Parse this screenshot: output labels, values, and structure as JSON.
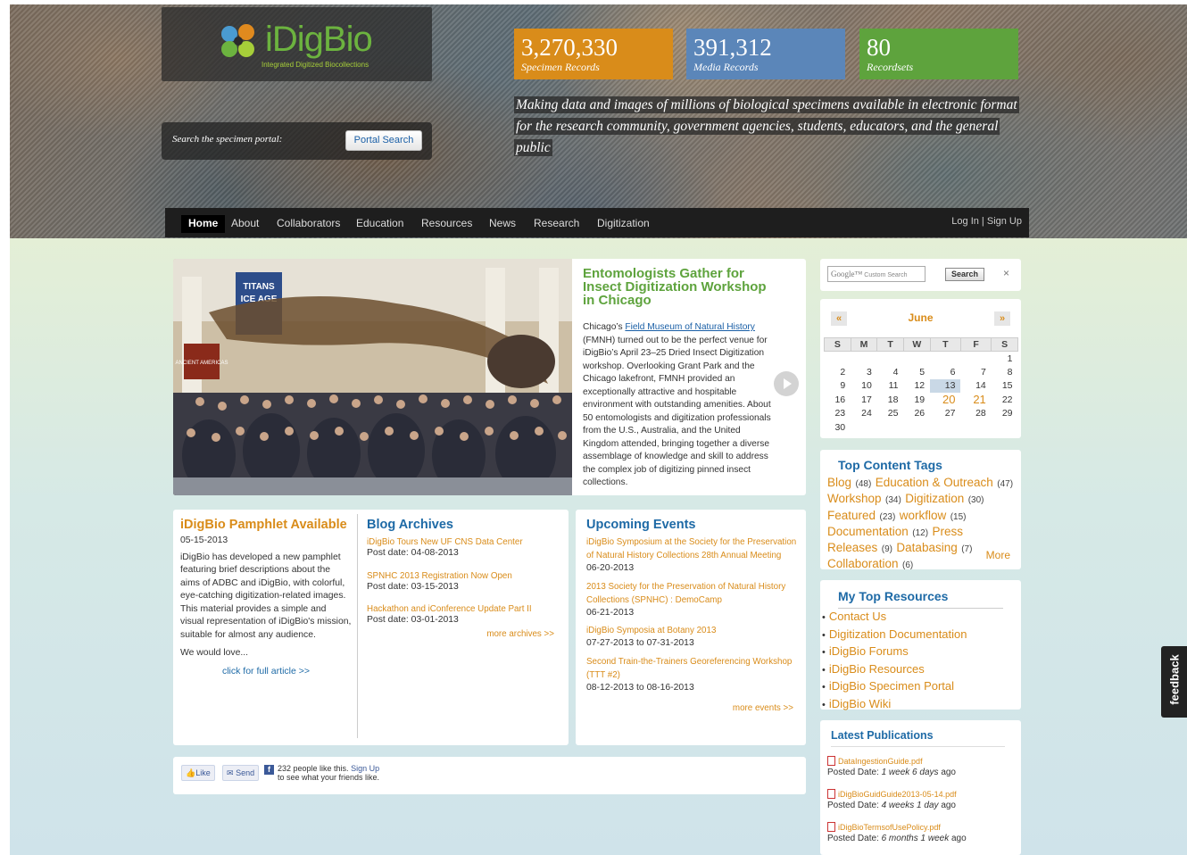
{
  "brand": {
    "logo_text": "iDigBio",
    "logo_sub": "Integrated Digitized Biocollections"
  },
  "search": {
    "label": "Search the specimen portal:",
    "button": "Portal Search"
  },
  "stats": [
    {
      "value": "3,270,330",
      "label": "Specimen Records",
      "color": "#d98c1a"
    },
    {
      "value": "391,312",
      "label": "Media Records",
      "color": "#5b86b9"
    },
    {
      "value": "80",
      "label": "Recordsets",
      "color": "#5ea33d"
    }
  ],
  "tagline": "Making data and images of millions of biological specimens available in electronic format for the research community, government agencies, students, educators, and the general public",
  "nav": {
    "items": [
      "Home",
      "About",
      "Collaborators",
      "Education",
      "Resources",
      "News",
      "Research",
      "Digitization"
    ],
    "active": "Home",
    "login": "Log In",
    "signup": "Sign Up"
  },
  "slide": {
    "title": "Entomologists Gather for Insect Digitization Workshop in Chicago",
    "body_pre": "Chicago’s ",
    "body_link": "Field Museum of Natural History",
    "body_post": " (FMNH) turned out to be the perfect venue for iDigBio’s April 23–25 Dried Insect Digitization workshop. Overlooking Grant Park and the Chicago lakefront, FMNH provided an exceptionally attractive and hospitable environment with outstanding amenities. About 50 entomologists and digitization professionals from the U.S., Australia, and the United Kingdom attended, bringing together a diverse assemblage of knowledge and skill to address the complex job of digitizing pinned insect collections.",
    "banner_1": "TITANS",
    "banner_2": "ICE AGE",
    "banner_3": "ANCIENT AMERICAS"
  },
  "pamphlet": {
    "title": "iDigBio Pamphlet Available",
    "date": "05-15-2013",
    "body": "iDigBio has developed a new pamphlet featuring brief descriptions about the aims of ADBC and iDigBio, with colorful, eye-catching digitization-related images. This material provides a simple and visual representation of iDigBio's mission, suitable for almost any audience.",
    "more": "We would love...",
    "link": "click for full article >>"
  },
  "archives": {
    "title": "Blog Archives",
    "items": [
      {
        "title": "iDigBio Tours New UF CNS Data Center",
        "date": "Post date: 04-08-2013"
      },
      {
        "title": "SPNHC 2013 Registration Now Open",
        "date": "Post date: 03-15-2013"
      },
      {
        "title": "Hackathon and iConference Update Part II",
        "date": "Post date: 03-01-2013"
      }
    ],
    "more": "more archives >>"
  },
  "events": {
    "title": "Upcoming Events",
    "items": [
      {
        "title": "iDigBio Symposium at the Society for the Preservation of Natural History Collections 28th Annual Meeting",
        "date": "06-20-2013"
      },
      {
        "title": "2013 Society for the Preservation of Natural History Collections (SPNHC) : DemoCamp",
        "date": "06-21-2013"
      },
      {
        "title": "iDigBio Symposia at Botany 2013",
        "date": "07-27-2013 to 07-31-2013"
      },
      {
        "title": "Second Train-the-Trainers Georeferencing Workshop (TTT #2)",
        "date": "08-12-2013 to 08-16-2013"
      }
    ],
    "more": "more events >>"
  },
  "social": {
    "like": "Like",
    "send": "Send",
    "count_text": "232 people like this.",
    "signup": "Sign Up",
    "rest": "to see what your friends like."
  },
  "google": {
    "placeholder": "Custom Search",
    "google": "Google™",
    "button": "Search",
    "clear": "×"
  },
  "calendar": {
    "month": "June",
    "prev": "«",
    "next": "»",
    "days": [
      "S",
      "M",
      "T",
      "W",
      "T",
      "F",
      "S"
    ],
    "weeks": [
      [
        "",
        "",
        "",
        "",
        "",
        "",
        "1"
      ],
      [
        "2",
        "3",
        "4",
        "5",
        "6",
        "7",
        "8"
      ],
      [
        "9",
        "10",
        "11",
        "12",
        "13",
        "14",
        "15"
      ],
      [
        "16",
        "17",
        "18",
        "19",
        "20",
        "21",
        "22"
      ],
      [
        "23",
        "24",
        "25",
        "26",
        "27",
        "28",
        "29"
      ],
      [
        "30",
        "",
        "",
        "",
        "",
        "",
        ""
      ]
    ],
    "today": "13",
    "highlight": [
      "20",
      "21"
    ]
  },
  "tags": {
    "title": "Top Content Tags",
    "items": [
      {
        "name": "Blog",
        "count": "(48)"
      },
      {
        "name": "Education & Outreach",
        "count": "(47)"
      },
      {
        "name": "Workshop",
        "count": "(34)"
      },
      {
        "name": "Digitization",
        "count": "(30)"
      },
      {
        "name": "Featured",
        "count": "(23)"
      },
      {
        "name": "workflow",
        "count": "(15)"
      },
      {
        "name": "Documentation",
        "count": "(12)"
      },
      {
        "name": "Press Releases",
        "count": "(9)"
      },
      {
        "name": "Databasing",
        "count": "(7)"
      },
      {
        "name": "Collaboration",
        "count": "(6)"
      }
    ],
    "more": "More"
  },
  "resources": {
    "title": "My Top Resources",
    "items": [
      "Contact Us",
      "Digitization Documentation",
      "iDigBio Forums",
      "iDigBio Resources",
      "iDigBio Specimen Portal",
      "iDigBio Wiki"
    ]
  },
  "publications": {
    "title": "Latest Publications",
    "items": [
      {
        "file": "DataIngestionGuide.pdf",
        "posted": "Posted Date:",
        "age": "1 week 6 days",
        "ago": "ago"
      },
      {
        "file": "iDigBioGuidGuide2013-05-14.pdf",
        "posted": "Posted Date:",
        "age": "4 weeks 1 day",
        "ago": "ago"
      },
      {
        "file": "iDigBioTermsofUsePolicy.pdf",
        "posted": "Posted Date:",
        "age": "6 months 1 week",
        "ago": "ago"
      }
    ]
  },
  "feedback": "feedback"
}
